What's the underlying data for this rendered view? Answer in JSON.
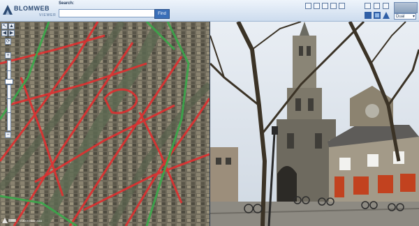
{
  "app": {
    "brand": "BLOMWEB",
    "brand_sub": "VIEWER"
  },
  "search": {
    "label": "Search:",
    "value": "",
    "placeholder": "",
    "button": "Find"
  },
  "view_mode": {
    "selected": "Dual"
  },
  "toolbar_icons": [
    "home-icon",
    "print-icon",
    "save-icon",
    "zoom-box-icon",
    "measure-icon",
    "info-icon",
    "oblique-view-icon",
    "layers-icon",
    "pan-icon",
    "orthophoto-icon",
    "street-view-icon",
    "map-icon"
  ],
  "map": {
    "copyright": "© 2009 Blom ASA"
  },
  "colors": {
    "accent": "#3a6fb8",
    "route_red": "#e03030",
    "route_green": "#3aa84a"
  }
}
